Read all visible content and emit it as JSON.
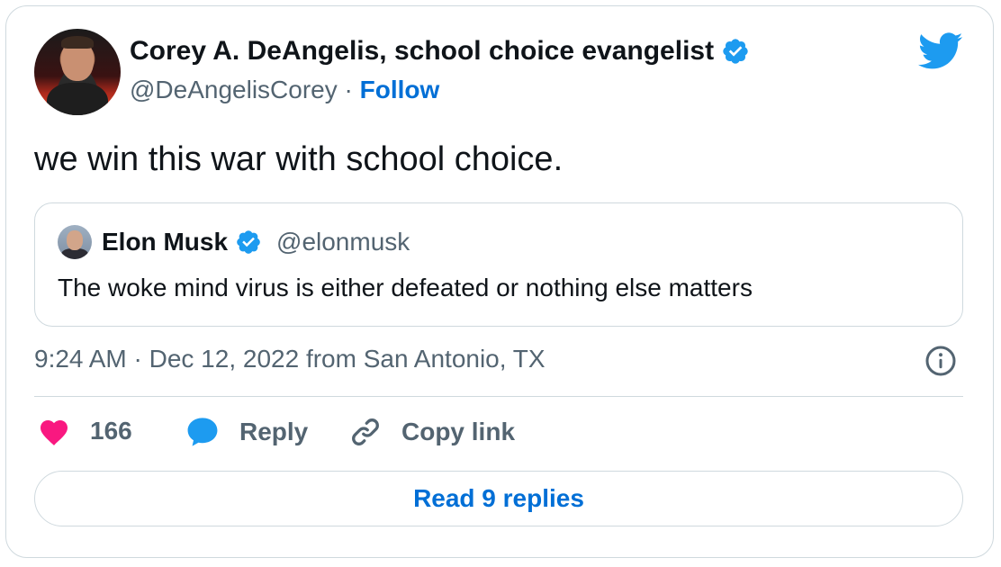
{
  "author": {
    "name": "Corey A. DeAngelis, school choice evangelist",
    "handle": "@DeAngelisCorey",
    "separator": "·",
    "follow_label": "Follow"
  },
  "tweet": {
    "text": "we win this war with school choice."
  },
  "quoted_tweet": {
    "name": "Elon Musk",
    "handle": "@elonmusk",
    "text": "The woke mind virus is either defeated or nothing else matters"
  },
  "meta": {
    "timestamp": "9:24 AM · Dec 12, 2022 from San Antonio, TX"
  },
  "actions": {
    "like_count": "166",
    "reply_label": "Reply",
    "copy_link_label": "Copy link",
    "read_replies_label": "Read 9 replies"
  },
  "icons": {
    "brand": "twitter-bird-icon",
    "verified": "verified-badge-icon",
    "info": "info-icon",
    "like": "heart-icon",
    "reply": "speech-bubble-icon",
    "copy_link": "link-icon"
  },
  "colors": {
    "brand_blue": "#1d9bf0",
    "link_blue": "#006fd6",
    "like_pink": "#f91880",
    "muted_text": "#536471",
    "border": "#cfd9de"
  }
}
